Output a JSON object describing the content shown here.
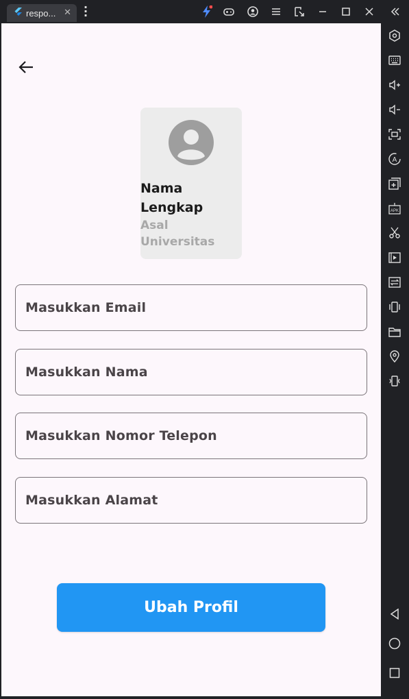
{
  "window": {
    "tab_title": "respo...",
    "tab_close": "✕",
    "accent": "#2196f3"
  },
  "toolbar_icons": [
    "bolt-icon",
    "gamepad-icon",
    "account-icon",
    "menu-icon",
    "resize-icon",
    "minimize-icon",
    "maximize-icon",
    "close-icon",
    "collapse-sidebar-icon"
  ],
  "sidebar_icons": [
    "settings-hex-icon",
    "keyboard-icon",
    "volume-up-icon",
    "volume-down-icon",
    "screenshot-icon",
    "rotate-icon",
    "multi-instance-icon",
    "apk-icon",
    "scissors-icon",
    "media-icon",
    "sync-icon",
    "shake-icon",
    "folder-icon",
    "location-icon",
    "vibrate-icon",
    "back-nav-icon",
    "home-nav-icon",
    "recents-nav-icon"
  ],
  "profile": {
    "name": "Nama Lengkap",
    "university": "Asal Universitas"
  },
  "form": {
    "email_placeholder": "Masukkan Email",
    "name_placeholder": "Masukkan Nama",
    "phone_placeholder": "Masukkan Nomor Telepon",
    "address_placeholder": "Masukkan Alamat"
  },
  "actions": {
    "submit_label": "Ubah Profil"
  }
}
